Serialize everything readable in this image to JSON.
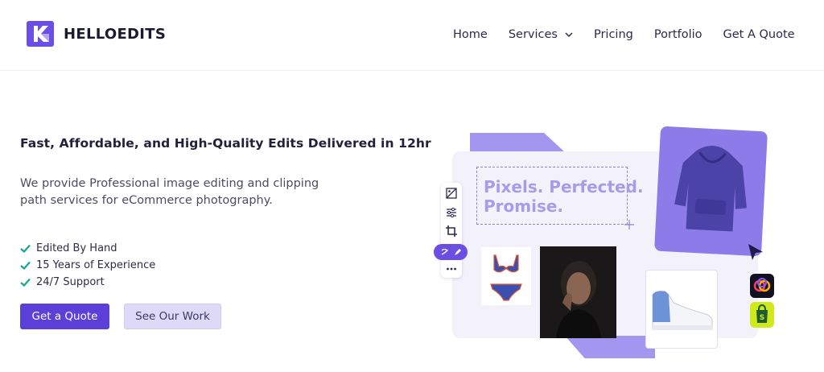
{
  "brand": {
    "name": "HELLOEDITS",
    "colors": {
      "primary": "#5b3fd9",
      "secondary_bg": "#ddd9f7",
      "accent_check": "#14a88a"
    }
  },
  "nav": {
    "items": [
      {
        "label": "Home"
      },
      {
        "label": "Services",
        "has_dropdown": true
      },
      {
        "label": "Pricing"
      },
      {
        "label": "Portfolio"
      },
      {
        "label": "Get A Quote"
      }
    ]
  },
  "hero": {
    "headline": "Fast, Affordable, and High-Quality Edits Delivered in 12hr",
    "subtext": "We provide Professional image editing and clipping path services for eCommerce photography.",
    "features": [
      "Edited By Hand",
      "15 Years of Experience",
      "24/7 Support"
    ],
    "primary_button": "Get a Quote",
    "secondary_button": "See Our Work"
  },
  "illustration": {
    "tagline_line1": "Pixels. Perfected.",
    "tagline_line2": "Promise.",
    "tools": [
      "image-icon",
      "sliders-icon",
      "crop-icon",
      "pen-tool-icon",
      "more-icon"
    ],
    "badges": [
      "creative-cloud-icon",
      "shopify-icon"
    ]
  }
}
